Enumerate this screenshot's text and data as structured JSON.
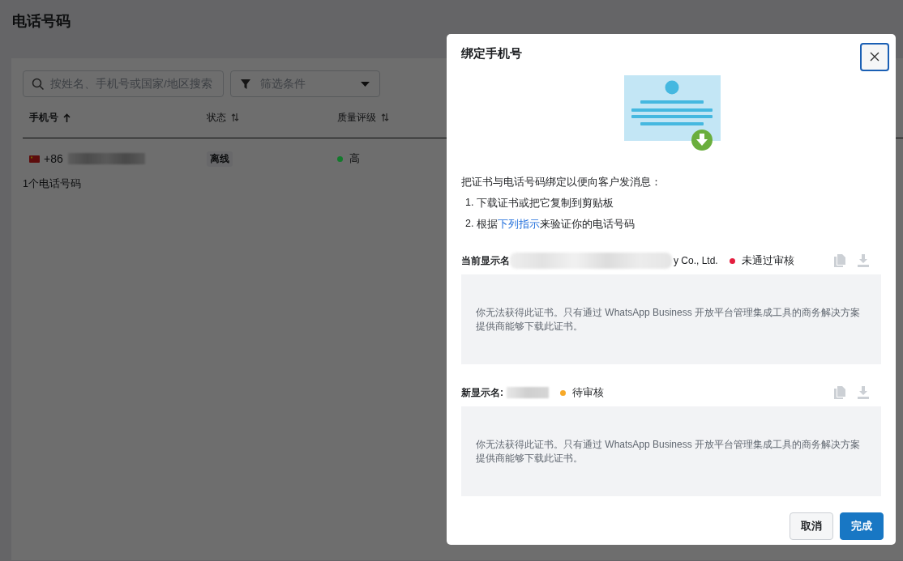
{
  "page": {
    "title": "电话号码"
  },
  "search": {
    "placeholder": "按姓名、手机号或国家/地区搜索"
  },
  "filter": {
    "placeholder": "筛选条件"
  },
  "table": {
    "columns": [
      {
        "label": "手机号",
        "sorted": true
      },
      {
        "label": "状态",
        "sorted": false
      },
      {
        "label": "质量评级",
        "sorted": false
      }
    ],
    "rows": [
      {
        "phone": "+86",
        "status": "离线",
        "quality": "高",
        "color": "#137a2c"
      }
    ]
  },
  "count": "1个电话号码",
  "dialog": {
    "title": "绑定手机号",
    "intro": "把证书与电话号码绑定以便向客户发消息：",
    "steps": [
      {
        "number": "1.",
        "before": "下载证书或把它复制到剪贴板"
      },
      {
        "number": "2.",
        "before": "根据",
        "link": "下列指示",
        "after": "来验证你的电话号码"
      }
    ],
    "certificates": [
      {
        "label": "当前显示名",
        "name_tail": "y Co., Ltd.",
        "status": "未通过审核",
        "color": "#e41e3f",
        "actions_disabled": true,
        "message": "你无法获得此证书。只有通过 WhatsApp Business 开放平台管理集成工具的商务解决方案提供商能够下载此证书。"
      },
      {
        "label": "新显示名:",
        "status": "待审核",
        "color": "#f7a928",
        "actions_disabled": true,
        "message": "你无法获得此证书。只有通过 WhatsApp Business 开放平台管理集成工具的商务解决方案提供商能够下载此证书。"
      }
    ],
    "buttons": [
      {
        "label": "取消",
        "kind": "secondary"
      },
      {
        "label": "完成",
        "kind": "primary"
      }
    ]
  }
}
